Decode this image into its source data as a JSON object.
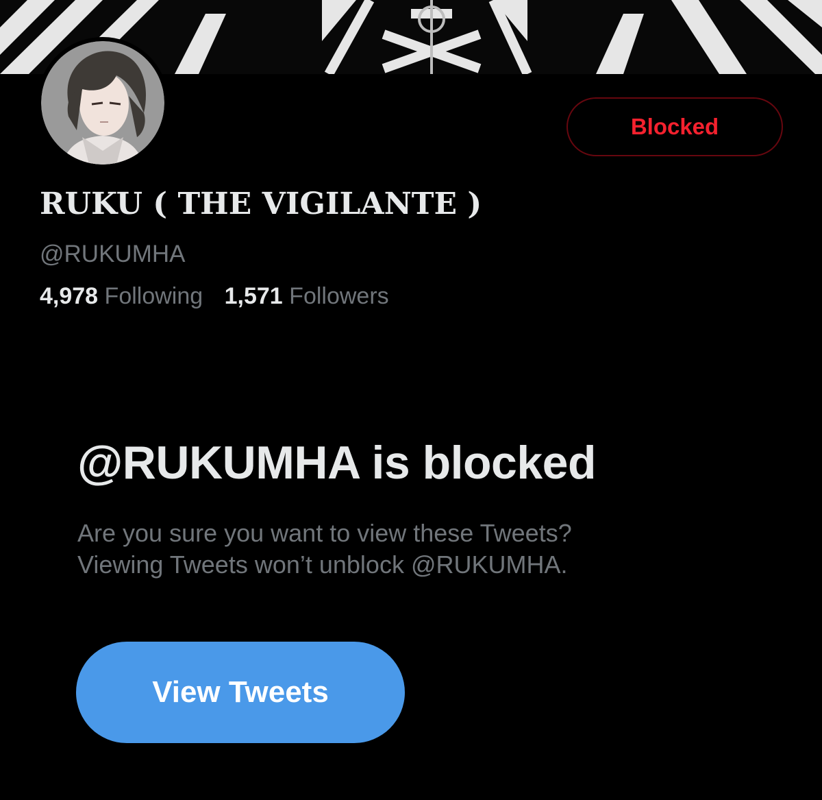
{
  "profile": {
    "display_name": "RUKU ( THE VIGILANTE )",
    "handle": "@RUKUMHA",
    "following_count": "4,978",
    "following_label": "Following",
    "followers_count": "1,571",
    "followers_label": "Followers",
    "avatar_icon": "profile-avatar-anime-portrait",
    "banner_icon": "black-white-geometric-banner"
  },
  "actions": {
    "blocked_label": "Blocked"
  },
  "blocked_notice": {
    "title": "@RUKUMHA is blocked",
    "message_line1": "Are you sure you want to view these Tweets?",
    "message_line2": "Viewing Tweets won’t unblock @RUKUMHA.",
    "view_button_label": "View Tweets"
  },
  "colors": {
    "background": "#000000",
    "primary_text": "#e7e9ea",
    "secondary_text": "#71767b",
    "blocked_red": "#f4212e",
    "blocked_border": "#67070f",
    "accent_blue": "#4a99e9"
  }
}
